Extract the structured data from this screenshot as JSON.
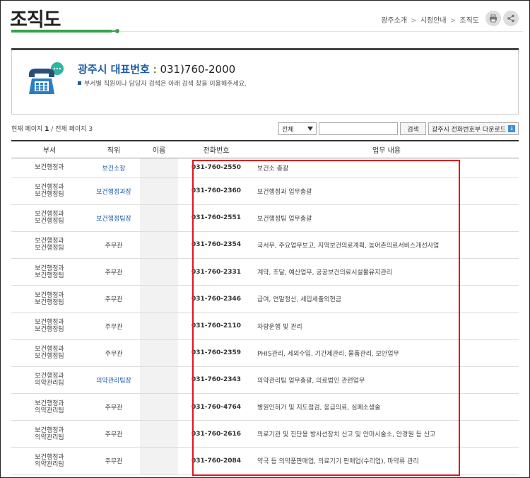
{
  "header": {
    "title": "조직도",
    "breadcrumb": [
      "광주소개",
      "시정안내",
      "조직도"
    ]
  },
  "info": {
    "rep_label": "광주시 대표번호",
    "rep_colon": ":",
    "rep_number": "031)760-2000",
    "note": "부서별 직원이나 담당자 검색은 아래 검색 창을 이용해주세요."
  },
  "toolbar": {
    "page_label_current": "현재 페이지",
    "page_current": "1",
    "page_sep": "/",
    "page_label_total": "전체 페이지",
    "page_total": "3",
    "select_value": "전체",
    "search_button": "검색",
    "download_button": "광주시 전화번호부 다운로드"
  },
  "table": {
    "headers": [
      "부서",
      "직위",
      "이름",
      "전화번호",
      "업무 내용"
    ],
    "rows": [
      {
        "dept": [
          "보건행정과"
        ],
        "position": "보건소장",
        "position_link": true,
        "phone": "031-760-2550",
        "duty": "보건소 총괄"
      },
      {
        "dept": [
          "보건행정과",
          "보건행정팀"
        ],
        "position": "보건행정과장",
        "position_link": true,
        "phone": "031-760-2360",
        "duty": "보건행정과 업무총괄"
      },
      {
        "dept": [
          "보건행정과",
          "보건행정팀"
        ],
        "position": "보건행정팀장",
        "position_link": true,
        "phone": "031-760-2551",
        "duty": "보건행정팀 업무총괄"
      },
      {
        "dept": [
          "보건행정과",
          "보건행정팀"
        ],
        "position": "주무관",
        "position_link": false,
        "phone": "031-760-2354",
        "duty": "국서무, 주요업무보고, 지역보건의료계획, 농어촌의료서비스개선사업"
      },
      {
        "dept": [
          "보건행정과",
          "보건행정팀"
        ],
        "position": "주무관",
        "position_link": false,
        "phone": "031-760-2331",
        "duty": "계약, 조달, 예산업무, 공공보건의료시설물유지관리"
      },
      {
        "dept": [
          "보건행정과",
          "보건행정팀"
        ],
        "position": "주무관",
        "position_link": false,
        "phone": "031-760-2346",
        "duty": "급여, 연말정산, 세입세출외현금"
      },
      {
        "dept": [
          "보건행정과",
          "보건행정팀"
        ],
        "position": "주무관",
        "position_link": false,
        "phone": "031-760-2110",
        "duty": "차량운행 및 관리"
      },
      {
        "dept": [
          "보건행정과",
          "보건행정팀"
        ],
        "position": "주무관",
        "position_link": false,
        "phone": "031-760-2359",
        "duty": "PHIS관리, 세외수입, 기간제관리, 물품관리, 보안업무"
      },
      {
        "dept": [
          "보건행정과",
          "의약관리팀"
        ],
        "position": "의약관리팀장",
        "position_link": true,
        "phone": "031-760-2343",
        "duty": "의약관리팀 업무총괄, 의료법인 관련업무"
      },
      {
        "dept": [
          "보건행정과",
          "의약관리팀"
        ],
        "position": "주무관",
        "position_link": false,
        "phone": "031-760-4764",
        "duty": "병원인허가 및 지도점검, 응급의료, 심폐소생술"
      },
      {
        "dept": [
          "보건행정과",
          "의약관리팀"
        ],
        "position": "주무관",
        "position_link": false,
        "phone": "031-760-2616",
        "duty": "의료기관 및 진단용 방사선장치 신고 및 안마시술소, 안경원 등 신고"
      },
      {
        "dept": [
          "보건행정과",
          "의약관리팀"
        ],
        "position": "주무관",
        "position_link": false,
        "phone": "031-760-2084",
        "duty": "약국 등 의약품판매업, 의료기기 판매업(수리업), 마약류 관리"
      }
    ]
  },
  "colors": {
    "accent_green": "#35a34a",
    "link_blue": "#1a5aa8",
    "highlight_red": "#e3141b"
  }
}
